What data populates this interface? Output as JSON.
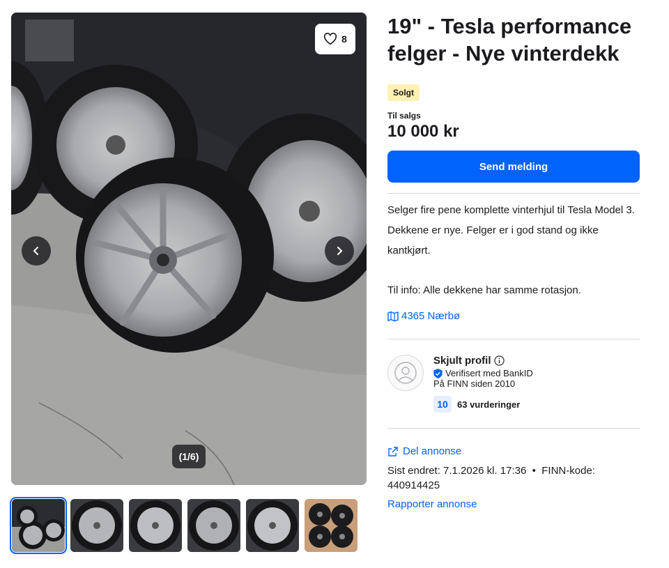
{
  "gallery": {
    "favorite_count": "8",
    "counter": "(1/6)",
    "thumbnails": [
      "wheels-stack",
      "wheel-1",
      "wheel-2",
      "wheel-3",
      "wheel-4",
      "center-caps"
    ]
  },
  "listing": {
    "title": "19\" - Tesla performance felger - Nye vinterdekk",
    "status_badge": "Solgt",
    "price_label": "Til salgs",
    "price": "10 000 kr",
    "send_button": "Send melding",
    "description_lines": [
      "Selger fire pene komplette vinterhjul til Tesla Model 3.",
      "Dekkene er nye. Felger er i god stand og ikke kantkjørt.",
      "Til info: Alle dekkene har samme rotasjon."
    ],
    "location": "4365 Nærbø"
  },
  "seller": {
    "name": "Skjult profil",
    "verified": "Verifisert med BankID",
    "member_since": "På FINN siden 2010",
    "score": "10",
    "reviews": "63 vurderinger"
  },
  "footer": {
    "share": "Del annonse",
    "last_edited": "Sist endret: 7.1.2026 kl. 17:36",
    "separator": "•",
    "finn_code_label": "FINN-kode:",
    "finn_code": "440914425",
    "report": "Rapporter annonse"
  },
  "colors": {
    "accent": "#0063fb",
    "badge": "#fff0b3"
  }
}
